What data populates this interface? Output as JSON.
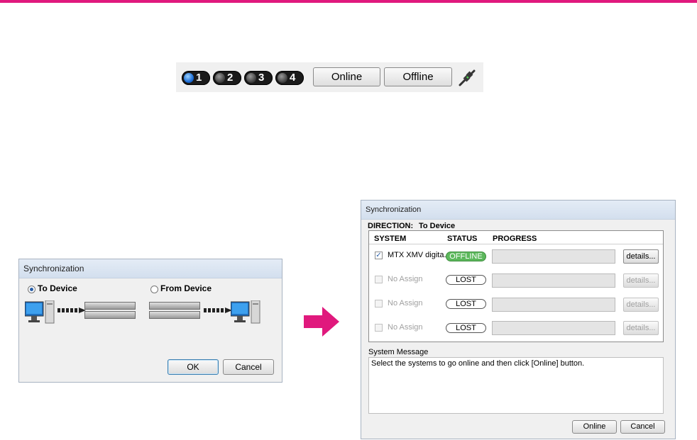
{
  "toolbar": {
    "systems": [
      {
        "label": "1",
        "active": true
      },
      {
        "label": "2",
        "active": false
      },
      {
        "label": "3",
        "active": false
      },
      {
        "label": "4",
        "active": false
      }
    ],
    "online_label": "Online",
    "offline_label": "Offline",
    "connection_icon": "plug-connected-icon"
  },
  "sync_dialog": {
    "title": "Synchronization",
    "to_device_label": "To Device",
    "from_device_label": "From Device",
    "selected": "To Device",
    "ok_label": "OK",
    "cancel_label": "Cancel"
  },
  "progress_dialog": {
    "title": "Synchronization",
    "direction_label": "DIRECTION:",
    "direction_value": "To Device",
    "columns": [
      "SYSTEM",
      "STATUS",
      "PROGRESS"
    ],
    "rows": [
      {
        "checked": true,
        "enabled": true,
        "system": "MTX XMV digita...",
        "status": "OFFLINE",
        "details": "details..."
      },
      {
        "checked": false,
        "enabled": false,
        "system": "No Assign",
        "status": "LOST",
        "details": "details..."
      },
      {
        "checked": false,
        "enabled": false,
        "system": "No Assign",
        "status": "LOST",
        "details": "details..."
      },
      {
        "checked": false,
        "enabled": false,
        "system": "No Assign",
        "status": "LOST",
        "details": "details..."
      }
    ],
    "message_label": "System Message",
    "message": "Select the systems to go online and then click [Online] button.",
    "online_label": "Online",
    "cancel_label": "Cancel"
  },
  "colors": {
    "accent_bar": "#e0197d",
    "offline_badge": "#5cb85c",
    "active_led": "#1d6fd8"
  }
}
